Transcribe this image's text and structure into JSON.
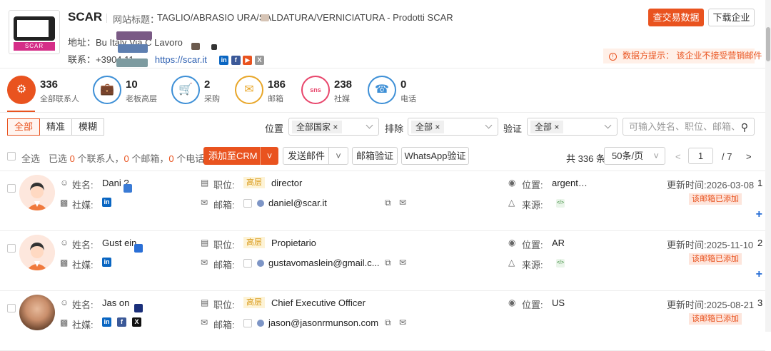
{
  "company": {
    "name": "SCAR",
    "logo_text": "SCAR",
    "site_title_label": "网站标题：",
    "site_title": "TAGLIO/ABRASIO          URA/SALDATURA/VERNICIATURA - Prodotti SCAR",
    "address_label": "地址：",
    "address": "Bu        Italy     Via C        Lavoro",
    "contact_label": "联系：",
    "phone": "+3904       11",
    "website": "https://scar.it",
    "buttons": {
      "trade_data": "查交易数据",
      "download": "下载企业"
    },
    "notice": "数据方提示：  该企业不接受营销邮件"
  },
  "stats": [
    {
      "count": "336",
      "label": "全部联系人",
      "icon": "contacts-icon",
      "color": "#e9531f"
    },
    {
      "count": "10",
      "label": "老板高层",
      "icon": "briefcase-icon",
      "color": "#3d8fd6"
    },
    {
      "count": "2",
      "label": "采购",
      "icon": "cart-icon",
      "color": "#3d8fd6"
    },
    {
      "count": "186",
      "label": "邮箱",
      "icon": "envelope-icon",
      "color": "#e8a628"
    },
    {
      "count": "238",
      "label": "社媒",
      "icon": "sns-icon",
      "color": "#e8456b"
    },
    {
      "count": "0",
      "label": "电话",
      "icon": "phone-icon",
      "color": "#3d8fd6"
    }
  ],
  "filters": {
    "tabs": [
      "全部",
      "精准",
      "模糊"
    ],
    "position_label": "位置",
    "position_value": "全部国家",
    "sort_label": "排除",
    "sort_value": "全部",
    "verify_label": "验证",
    "verify_value": "全部",
    "search_placeholder": "可输入姓名、职位、邮箱、"
  },
  "actions": {
    "select_all": "全选",
    "selected_prefix": "已选",
    "selected_contacts": "0",
    "contacts_unit": "个联系人，",
    "selected_emails": "0",
    "emails_unit": "个邮箱，",
    "selected_phones": "0",
    "phones_unit": "个电话",
    "add_crm": "添加至CRM",
    "send_mail": "发送邮件",
    "verify_mail": "邮箱验证",
    "whatsapp_verify": "WhatsApp验证",
    "total": "共 336 条",
    "page_size": "50条/页",
    "current_page": "1",
    "total_pages": "/ 7"
  },
  "labels": {
    "name": "姓名:",
    "social": "社媒:",
    "position": "职位:",
    "email": "邮箱:",
    "location": "位置:",
    "source": "来源:",
    "updated_prefix": "更新时间:",
    "mail_added": "该邮箱已添加",
    "senior": "高层"
  },
  "rows": [
    {
      "name": "Dani       ?",
      "title": "director",
      "email": "daniel@scar.it",
      "location": "argent…",
      "updated": "2026-03-08",
      "index": "1",
      "socials": [
        "in"
      ]
    },
    {
      "name": "Gust        ein",
      "title": "Propietario",
      "email": "gustavomaslein@gmail.c...",
      "location": "AR",
      "updated": "2025-11-10",
      "index": "2",
      "socials": [
        "in"
      ]
    },
    {
      "name": "Jas        on",
      "title": "Chief Executive Officer",
      "email": "jason@jasonrmunson.com",
      "location": "US",
      "updated": "2025-08-21",
      "index": "3",
      "socials": [
        "in",
        "f",
        "x"
      ]
    }
  ]
}
